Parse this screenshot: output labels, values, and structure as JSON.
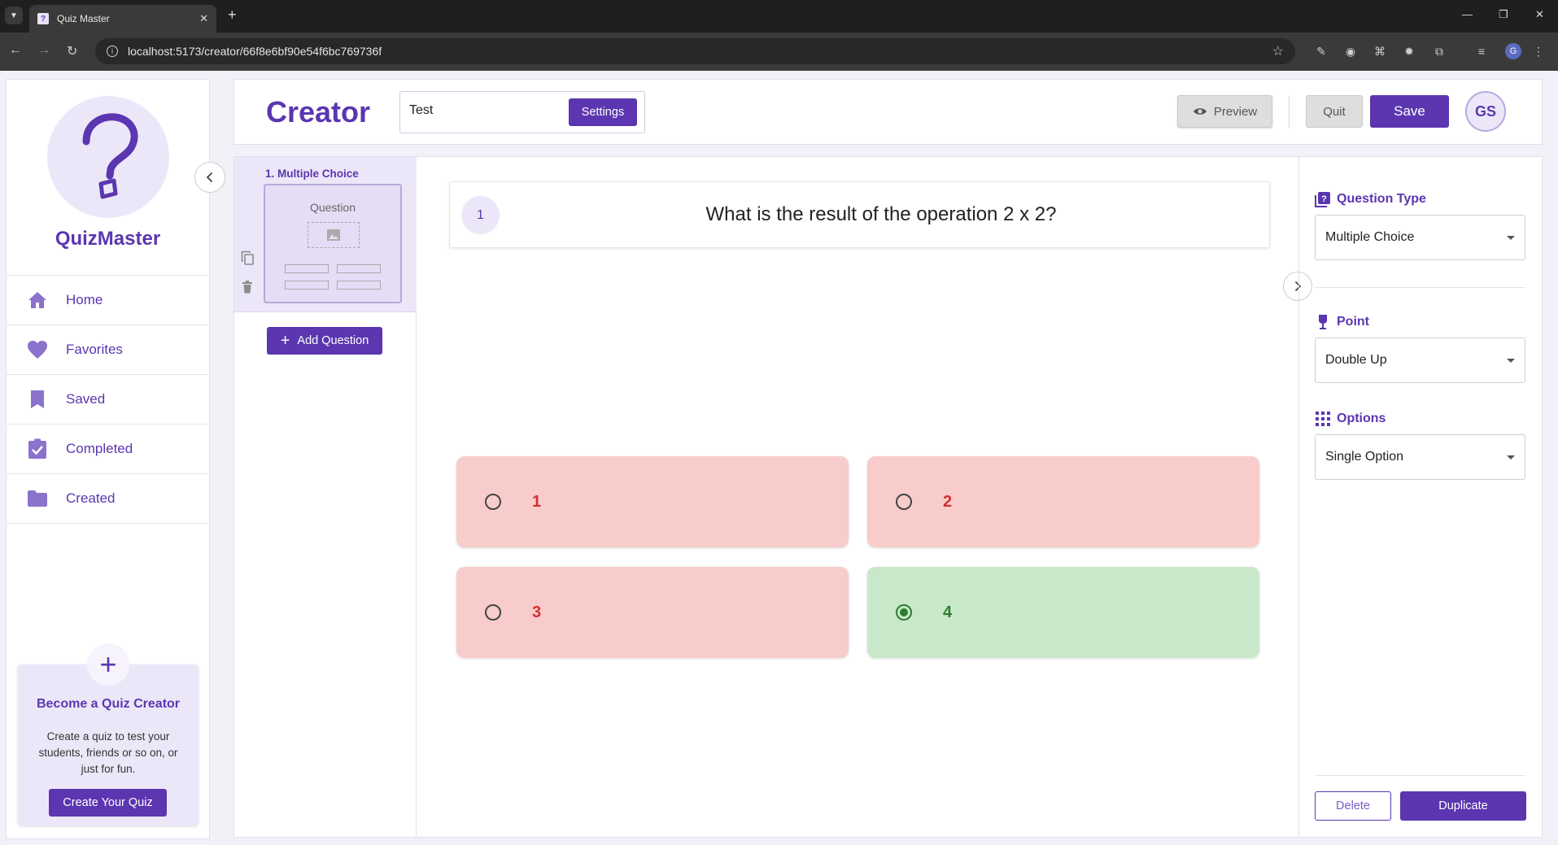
{
  "browser": {
    "tab_title": "Quiz Master",
    "url": "localhost:5173/creator/66f8e6bf90e54f6bc769736f",
    "profile_initial": "G"
  },
  "brand": {
    "name": "QuizMaster",
    "accent": "#5b36b0"
  },
  "sidebar": {
    "items": [
      {
        "label": "Home",
        "icon": "home-icon"
      },
      {
        "label": "Favorites",
        "icon": "heart-icon"
      },
      {
        "label": "Saved",
        "icon": "bookmark-icon"
      },
      {
        "label": "Completed",
        "icon": "clipboard-check-icon"
      },
      {
        "label": "Created",
        "icon": "folder-icon"
      }
    ],
    "card": {
      "title": "Become a Quiz Creator",
      "description": "Create a quiz to test your students, friends or so on, or just for fun.",
      "button": "Create Your Quiz"
    }
  },
  "header": {
    "title": "Creator",
    "quiz_title_value": "Test",
    "settings_label": "Settings",
    "preview_label": "Preview",
    "quit_label": "Quit",
    "save_label": "Save",
    "avatar_initials": "GS"
  },
  "question_list": {
    "items": [
      {
        "label": "1. Multiple Choice",
        "thumb_label": "Question"
      }
    ],
    "add_label": "Add Question"
  },
  "editor": {
    "question_number": "1",
    "question_text": "What is the result of the operation 2 x 2?",
    "options": [
      {
        "text": "1",
        "correct": false
      },
      {
        "text": "2",
        "correct": false
      },
      {
        "text": "3",
        "correct": false
      },
      {
        "text": "4",
        "correct": true
      }
    ]
  },
  "settings_panel": {
    "question_type": {
      "label": "Question Type",
      "value": "Multiple Choice"
    },
    "point": {
      "label": "Point",
      "value": "Double Up"
    },
    "options": {
      "label": "Options",
      "value": "Single Option"
    },
    "delete_label": "Delete",
    "duplicate_label": "Duplicate"
  }
}
